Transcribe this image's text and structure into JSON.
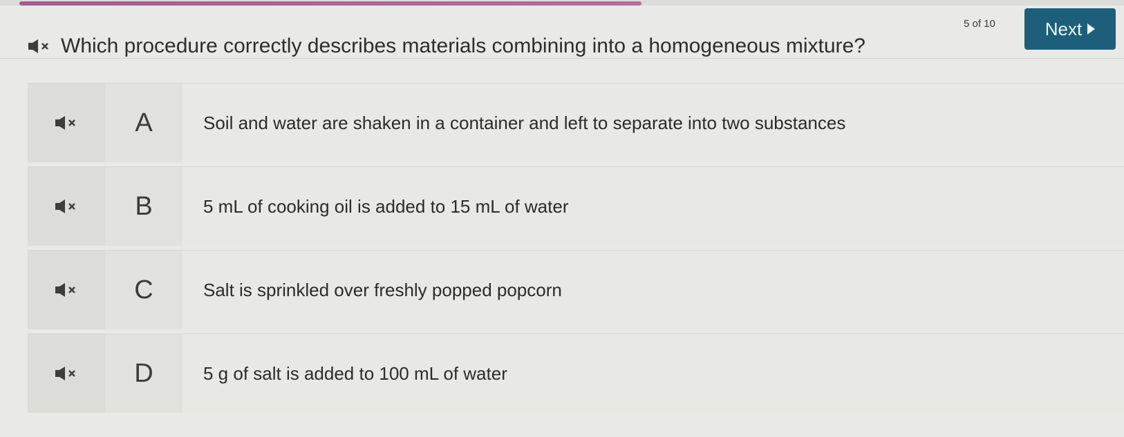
{
  "progress": {
    "fraction": 0.5
  },
  "header": {
    "counter": "5 of 10",
    "next_label": "Next"
  },
  "question": {
    "text": "Which procedure correctly describes materials combining into a homogeneous mixture?",
    "audio_icon": "speaker-icon"
  },
  "options": [
    {
      "letter": "A",
      "text": "Soil and water are shaken in a container and left to separate into two substances"
    },
    {
      "letter": "B",
      "text": "5 mL of cooking oil is added to 15 mL of water"
    },
    {
      "letter": "C",
      "text": "Salt is sprinkled over freshly popped popcorn"
    },
    {
      "letter": "D",
      "text": "5 g of salt is added to 100 mL of water"
    }
  ],
  "colors": {
    "next_button": "#1d5f7b",
    "progress": "#a65a8f",
    "background": "#e9e9e7"
  }
}
